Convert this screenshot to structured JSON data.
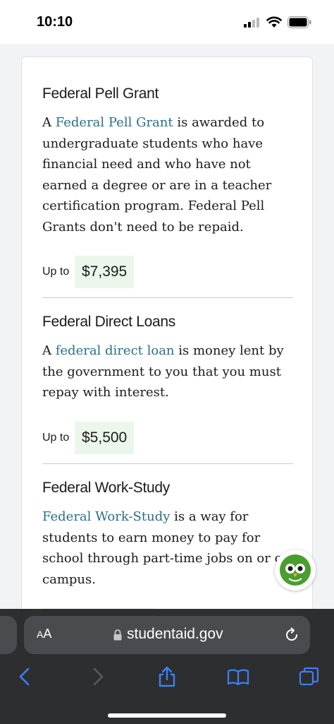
{
  "status_bar": {
    "time": "10:10"
  },
  "sections": [
    {
      "title": "Federal Pell Grant",
      "link_text": "Federal Pell Grant",
      "pre_text": "A ",
      "post_text": " is awarded to undergraduate students who have financial need and who have not earned a degree or are in a teacher certification program. Federal Pell Grants don't need to be repaid.",
      "up_to_label": "Up to",
      "amount": "$7,395"
    },
    {
      "title": "Federal Direct Loans",
      "link_text": "federal direct loan",
      "pre_text": "A ",
      "post_text": " is money lent by the government to you that you must repay with interest.",
      "up_to_label": "Up to",
      "amount": "$5,500"
    },
    {
      "title": "Federal Work-Study",
      "link_text": "Federal Work-Study",
      "pre_text": "",
      "post_text": " is a way for students to earn money to pay for school through part-time jobs on or off campus."
    }
  ],
  "browser": {
    "aa_small": "A",
    "aa_large": "A",
    "url": "studentaid.gov"
  },
  "colors": {
    "link": "#2a6f86",
    "amount_bg": "#ecf7ec",
    "toolbar_icon": "#3b82f6",
    "browser_bg": "#2d2e30"
  }
}
